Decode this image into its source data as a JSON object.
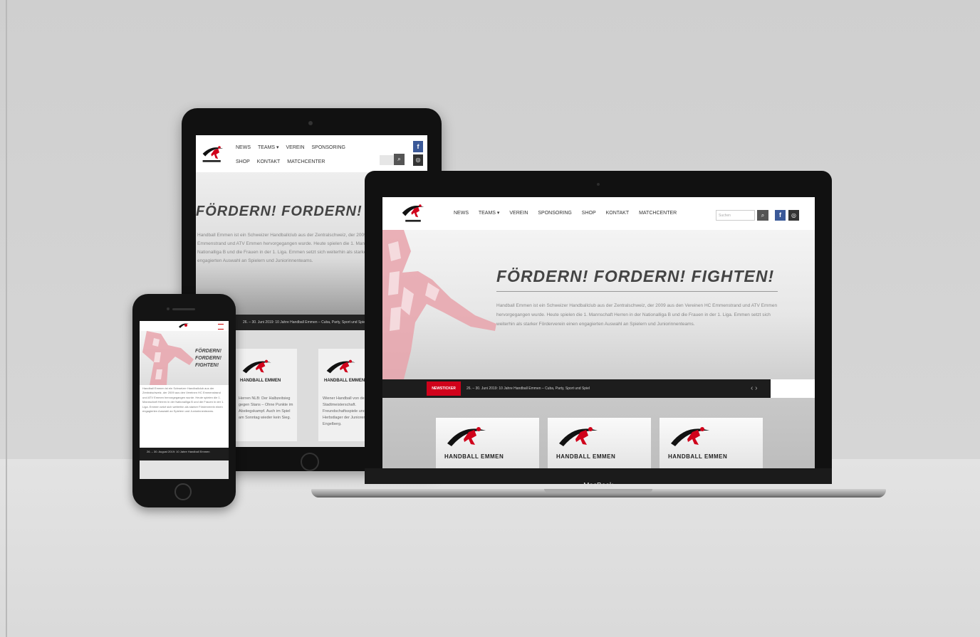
{
  "device_brand": "MacBook",
  "laptop": {
    "nav": [
      "NEWS",
      "TEAMS ▾",
      "VEREIN",
      "SPONSORING",
      "SHOP",
      "KONTAKT",
      "MATCHCENTER"
    ],
    "search_placeholder": "Suchen",
    "headline": "FÖRDERN! FORDERN! FIGHTEN!",
    "intro": "Handball Emmen ist ein Schweizer Handballclub aus der Zentralschweiz, der 2009 aus den Vereinen HC Emmenstrand und ATV Emmen hervorgegangen wurde. Heute spielen die 1. Mannschaft Herren in der Nationalliga B und die Frauen in der 1. Liga. Emmen setzt sich weiterhin als starker Förderverein einen engagierten Auswahl an Spielern und Juniorinnenteams.",
    "ticker_badge": "NEWSTICKER",
    "ticker_text": "26. – 30. Juni 2019: 10 Jahre Handball Emmen – Cuba, Party, Sport und Spiel",
    "cards": [
      {
        "label": "HANDBALL EMMEN"
      },
      {
        "label": "HANDBALL EMMEN"
      },
      {
        "label": "HANDBALL EMMEN"
      }
    ]
  },
  "tablet": {
    "nav_row1": [
      "NEWS",
      "TEAMS ▾",
      "VEREIN",
      "SPONSORING"
    ],
    "nav_row2": [
      "SHOP",
      "KONTAKT",
      "MATCHCENTER"
    ],
    "headline": "FÖRDERN! FORDERN! FI",
    "intro": "Handball Emmen ist ein Schweizer Handballclub aus der Zentralschweiz, der 2009 aus den Vereinen HC Emmenstrand und ATV Emmen hervorgegangen wurde. Heute spielen die 1. Mannschaft Herren in der Nationalliga B und die Frauen in der 1. Liga. Emmen setzt sich weiterhin als starker Förderverein einen engagierten Auswahl an Spielern und Juniorinnenteams.",
    "ticker_text": "26. – 30. Juni 2019: 10 Jahre Handball Emmen – Cuba, Party, Sport und Spiel",
    "cards": [
      {
        "label": "HANDBALL EMMEN",
        "text": "Herren NLB: Der Halbzeitsieg gegen Stans – Ohne Punkte im Abstiegskampf. Auch im Spiel am Sonntag wieder kein Sieg."
      },
      {
        "label": "HANDBALL EMMEN",
        "text": "Wiener Handball von der Stadtmeisterschaft. Freundschaftsspiele und Herbstlager der Junioren in Engelberg."
      }
    ]
  },
  "phone": {
    "headline": "FÖRDERN! FORDERN! FIGHTEN!",
    "intro": "Handball Emmen ist ein Schweizer Handballclub aus der Zentralschweiz, der 2009 aus den Vereinen HC Emmenstrand und ATV Emmen hervorgegangen wurde. Heute spielen die 1. Mannschaft Herren in der Nationalliga B und die Frauen in der 1. Liga. Emmen setzt sich weiterhin als starker Förderverein einen engagierten Auswahl an Spielern und Juniorinnenteams.",
    "ticker_text": "26. – 30. August 2019: 10 Jahre Handball Emmen"
  },
  "colors": {
    "brand_red": "#d0021b",
    "facebook_blue": "#3b5998"
  }
}
